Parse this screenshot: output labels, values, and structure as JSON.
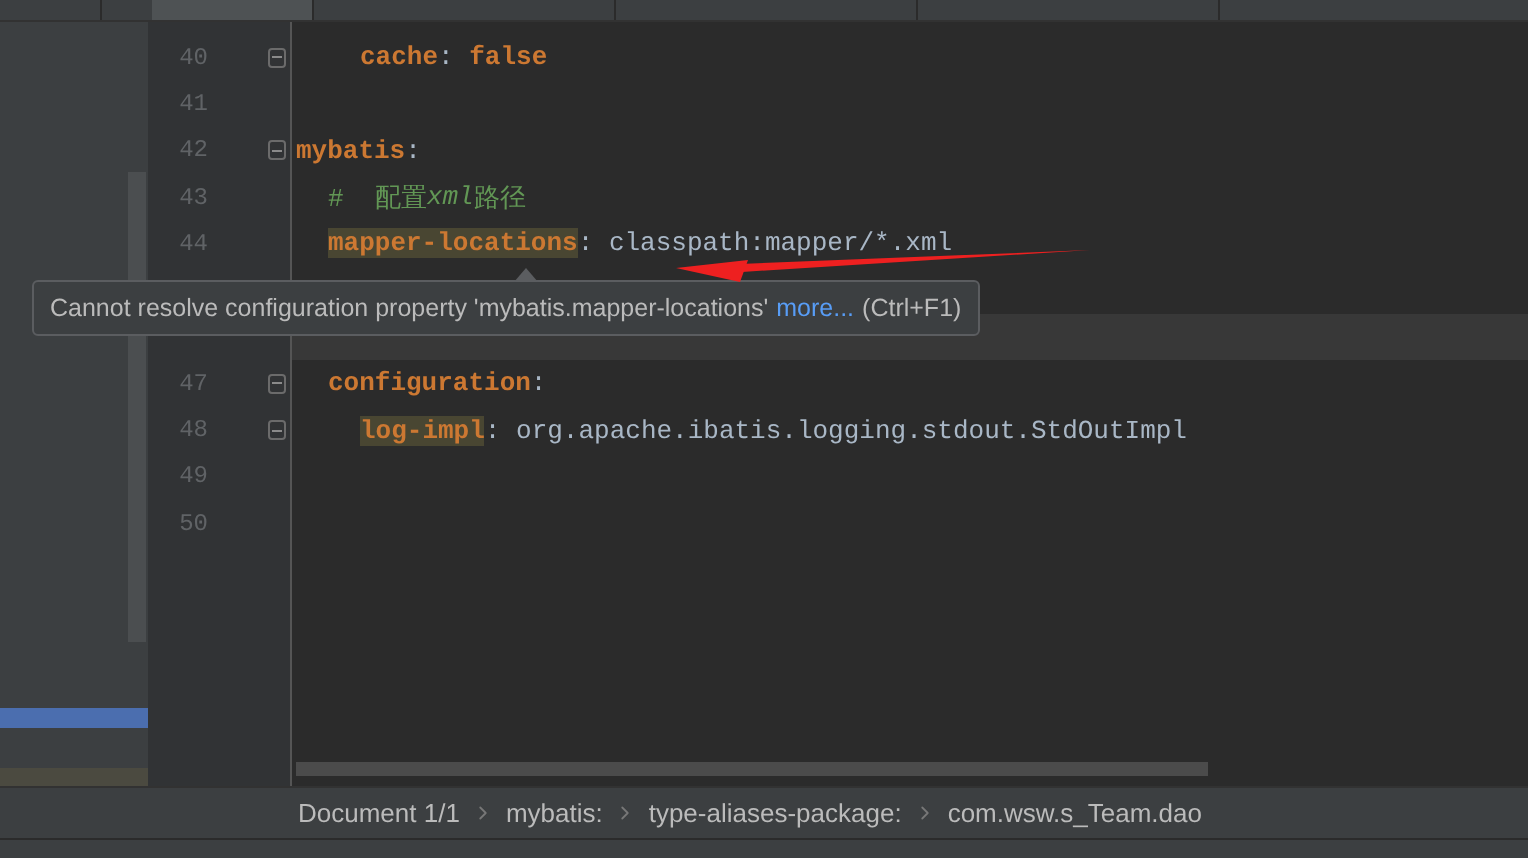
{
  "tabs": [
    {
      "selected": false
    },
    {
      "selected": true
    },
    {
      "selected": false
    },
    {
      "selected": false
    },
    {
      "selected": false
    }
  ],
  "editor": {
    "lines": [
      {
        "kind": "tail",
        "number": "40",
        "fold": true,
        "current": false,
        "tokens": [
          {
            "kind": "key",
            "text": "cache",
            "highlighted": false
          },
          {
            "kind": "punct",
            "text": ": "
          },
          {
            "kind": "keyword",
            "text": "false"
          }
        ]
      },
      {
        "kind": "line",
        "number": "41",
        "current": false
      },
      {
        "kind": "line",
        "number": "42",
        "fold": true,
        "current": false,
        "tokens": [
          {
            "kind": "key",
            "text": "mybatis",
            "highlighted": false
          },
          {
            "kind": "punct",
            "text": ":"
          }
        ],
        "children": [
          {
            "kind": "line",
            "number": "43",
            "current": false,
            "tokens": [
              {
                "kind": "comment",
                "text": "#  配置"
              },
              {
                "kind": "comment_italic",
                "text": "xml"
              },
              {
                "kind": "comment",
                "text": "路径"
              }
            ]
          },
          {
            "kind": "line",
            "number": "44",
            "current": false,
            "tokens": [
              {
                "kind": "key",
                "text": "mapper-locations",
                "highlighted": true
              },
              {
                "kind": "punct",
                "text": ": "
              },
              {
                "kind": "value",
                "text": "classpath:mapper/*.xml"
              }
            ]
          },
          {
            "kind": "hidden",
            "current": false
          },
          {
            "kind": "hidden",
            "current": true
          },
          {
            "kind": "line",
            "number": "47",
            "fold": true,
            "current": false,
            "tokens": [
              {
                "kind": "key",
                "text": "configuration",
                "highlighted": false
              },
              {
                "kind": "punct",
                "text": ":"
              }
            ],
            "children": [
              {
                "kind": "line",
                "number": "48",
                "fold": true,
                "current": false,
                "tokens": [
                  {
                    "kind": "key",
                    "text": "log-impl",
                    "highlighted": true
                  },
                  {
                    "kind": "punct",
                    "text": ": "
                  },
                  {
                    "kind": "value",
                    "text": "org.apache.ibatis.logging.stdout.StdOutImpl"
                  }
                ]
              },
              {
                "kind": "line",
                "number": "49",
                "current": false
              },
              {
                "kind": "line",
                "number": "50",
                "current": false
              }
            ]
          }
        ]
      }
    ]
  },
  "tooltip": {
    "message": "Cannot resolve configuration property 'mybatis.mapper-locations'",
    "link": "more...",
    "shortcut": "(Ctrl+F1)"
  },
  "breadcrumbs": [
    "Document 1/1",
    "mybatis:",
    "type-aliases-package:",
    "com.wsw.s_Team.dao"
  ]
}
